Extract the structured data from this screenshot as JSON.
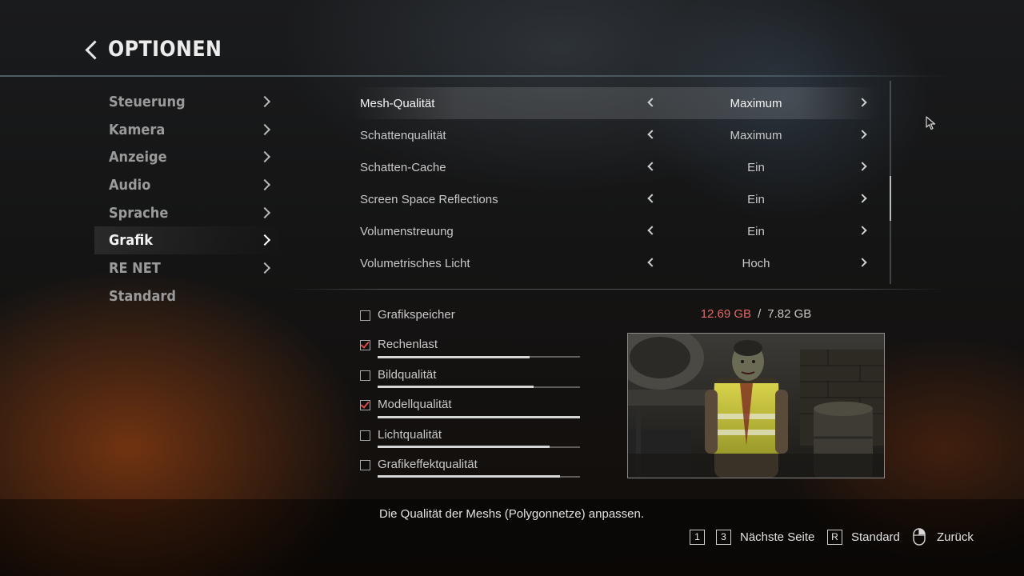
{
  "header": {
    "title": "OPTIONEN"
  },
  "sidebar": {
    "items": [
      {
        "label": "Steuerung",
        "has_arrow": true
      },
      {
        "label": "Kamera",
        "has_arrow": true
      },
      {
        "label": "Anzeige",
        "has_arrow": true
      },
      {
        "label": "Audio",
        "has_arrow": true
      },
      {
        "label": "Sprache",
        "has_arrow": true
      },
      {
        "label": "Grafik",
        "has_arrow": true,
        "active": true
      },
      {
        "label": "RE NET",
        "has_arrow": true
      },
      {
        "label": "Standard",
        "has_arrow": false
      }
    ]
  },
  "settings": [
    {
      "name": "Mesh-Qualität",
      "value": "Maximum",
      "selected": true
    },
    {
      "name": "Schattenqualität",
      "value": "Maximum"
    },
    {
      "name": "Schatten-Cache",
      "value": "Ein"
    },
    {
      "name": "Screen Space Reflections",
      "value": "Ein"
    },
    {
      "name": "Volumenstreuung",
      "value": "Ein"
    },
    {
      "name": "Volumetrisches Licht",
      "value": "Hoch"
    }
  ],
  "scrollbar": {
    "position_fraction": 0.47
  },
  "load_breakdown": [
    {
      "label": "Grafikspeicher",
      "checked": false,
      "level": null
    },
    {
      "label": "Rechenlast",
      "checked": true,
      "level": 0.75
    },
    {
      "label": "Bildqualität",
      "checked": false,
      "level": 0.77
    },
    {
      "label": "Modellqualität",
      "checked": true,
      "level": 1.0
    },
    {
      "label": "Lichtqualität",
      "checked": false,
      "level": 0.85
    },
    {
      "label": "Grafikeffektqualität",
      "checked": false,
      "level": 0.9
    }
  ],
  "memory": {
    "used": "12.69 GB",
    "separator": "/",
    "total": "7.82 GB",
    "over_limit_color": "#e06a6a"
  },
  "preview": {
    "icon": "zombie-preview-image"
  },
  "description": "Die Qualität der Meshs (Polygonnetze) anpassen.",
  "footer": {
    "key1": "1",
    "key3": "3",
    "next_page": "Nächste Seite",
    "key_r": "R",
    "standard": "Standard",
    "back": "Zurück"
  },
  "colors": {
    "accent_red": "#e04848",
    "text": "#c8c8c8",
    "text_active": "#f4f4f4"
  }
}
